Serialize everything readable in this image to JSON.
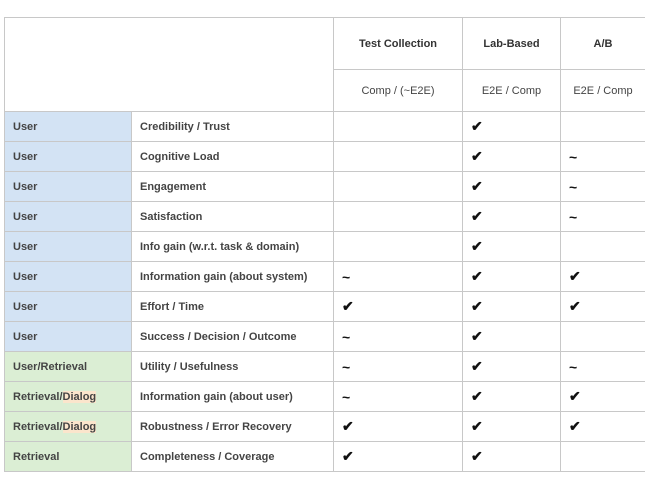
{
  "header": {
    "columns": [
      "Test Collection",
      "Lab-Based",
      "A/B"
    ],
    "subheaders": [
      "Comp / (~E2E)",
      "E2E / Comp",
      "E2E / Comp"
    ]
  },
  "rows": [
    {
      "category": "User",
      "metric": "Credibility / Trust",
      "test": "",
      "lab": "✔",
      "ab": ""
    },
    {
      "category": "User",
      "metric": "Cognitive Load",
      "test": "",
      "lab": "✔",
      "ab": "~"
    },
    {
      "category": "User",
      "metric": "Engagement",
      "test": "",
      "lab": "✔",
      "ab": "~"
    },
    {
      "category": "User",
      "metric": "Satisfaction",
      "test": "",
      "lab": "✔",
      "ab": "~"
    },
    {
      "category": "User",
      "metric": "Info gain (w.r.t. task & domain)",
      "test": "",
      "lab": "✔",
      "ab": ""
    },
    {
      "category": "User",
      "metric": "Information gain (about system)",
      "test": "~",
      "lab": "✔",
      "ab": "✔"
    },
    {
      "category": "User",
      "metric": "Effort / Time",
      "test": "✔",
      "lab": "✔",
      "ab": "✔"
    },
    {
      "category": "User",
      "metric": "Success / Decision / Outcome",
      "test": "~",
      "lab": "✔",
      "ab": ""
    },
    {
      "category_a": "User",
      "category_b": "/Retrieval",
      "metric": "Utility / Usefulness",
      "test": "~",
      "lab": "✔",
      "ab": "~"
    },
    {
      "category_a": "Retrieval/",
      "category_b": "Dialog",
      "metric": "Information gain (about user)",
      "test": "~",
      "lab": "✔",
      "ab": "✔"
    },
    {
      "category_a": "Retrieval/",
      "category_b": "Dialog",
      "metric": "Robustness / Error Recovery",
      "test": "✔",
      "lab": "✔",
      "ab": "✔"
    },
    {
      "category": "Retrieval",
      "metric": "Completeness / Coverage",
      "test": "✔",
      "lab": "✔",
      "ab": ""
    }
  ]
}
